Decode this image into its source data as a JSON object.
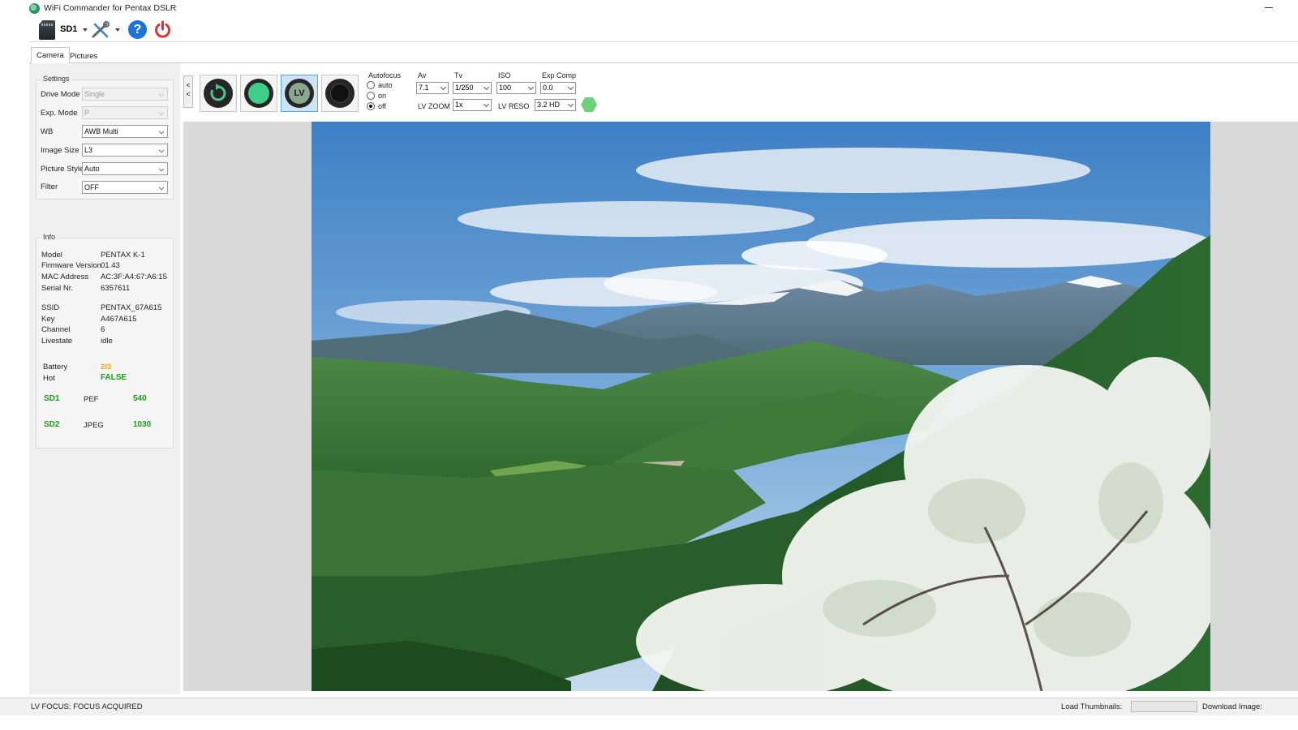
{
  "window": {
    "title": "WiFi Commander for Pentax DSLR"
  },
  "toolbar": {
    "sd_label": "SD1"
  },
  "tabs": [
    {
      "label": "Camera"
    },
    {
      "label": "Pictures"
    }
  ],
  "settings": {
    "title": "Settings",
    "drive_mode": {
      "label": "Drive Mode",
      "value": "Single"
    },
    "exp_mode": {
      "label": "Exp. Mode",
      "value": "P"
    },
    "wb": {
      "label": "WB",
      "value": "AWB Multi"
    },
    "image_size": {
      "label": "Image Size",
      "value": "L3"
    },
    "picture_style": {
      "label": "Picture Style",
      "value": "Auto"
    },
    "filter": {
      "label": "Filter",
      "value": "OFF"
    }
  },
  "info": {
    "title": "Info",
    "model": {
      "label": "Model",
      "value": "PENTAX K-1"
    },
    "firmware": {
      "label": "Firmware Version",
      "value": "01.43"
    },
    "mac": {
      "label": "MAC Address",
      "value": "AC:3F:A4:67:A6:15"
    },
    "serial": {
      "label": "Serial Nr.",
      "value": "6357611"
    },
    "ssid": {
      "label": "SSID",
      "value": "PENTAX_67A615"
    },
    "key": {
      "label": "Key",
      "value": "A467A615"
    },
    "channel": {
      "label": "Channel",
      "value": "6"
    },
    "livestate": {
      "label": "Livestate",
      "value": "idle"
    },
    "battery": {
      "label": "Battery",
      "value": "2/3"
    },
    "hot": {
      "label": "Hot",
      "value": "FALSE"
    },
    "sd1": {
      "label": "SD1",
      "format": "PEF",
      "count": "540"
    },
    "sd2": {
      "label": "SD2",
      "format": "JPEG",
      "count": "1030"
    }
  },
  "controls": {
    "collapse": "<\n<",
    "lv_label": "LV",
    "autofocus": {
      "label": "Autofocus",
      "options": [
        "auto",
        "on",
        "off"
      ],
      "selected": "off"
    },
    "av": {
      "label": "Av",
      "value": "7.1"
    },
    "tv": {
      "label": "Tv",
      "value": "1/250"
    },
    "iso": {
      "label": "ISO",
      "value": "100"
    },
    "exp_comp": {
      "label": "Exp Comp",
      "value": "0.0"
    },
    "lv_zoom": {
      "label": "LV ZOOM",
      "value": "1x"
    },
    "lv_reso": {
      "label": "LV RESO",
      "value": "3.2 HD"
    }
  },
  "statusbar": {
    "text": "LV FOCUS: FOCUS ACQUIRED",
    "load_thumbnails": "Load Thumbnails:",
    "download_image": "Download Image:"
  },
  "colors": {
    "accent_green": "#1a9c1a",
    "battery_orange": "#f2a20e",
    "selected_blue": "#cde4f7"
  }
}
